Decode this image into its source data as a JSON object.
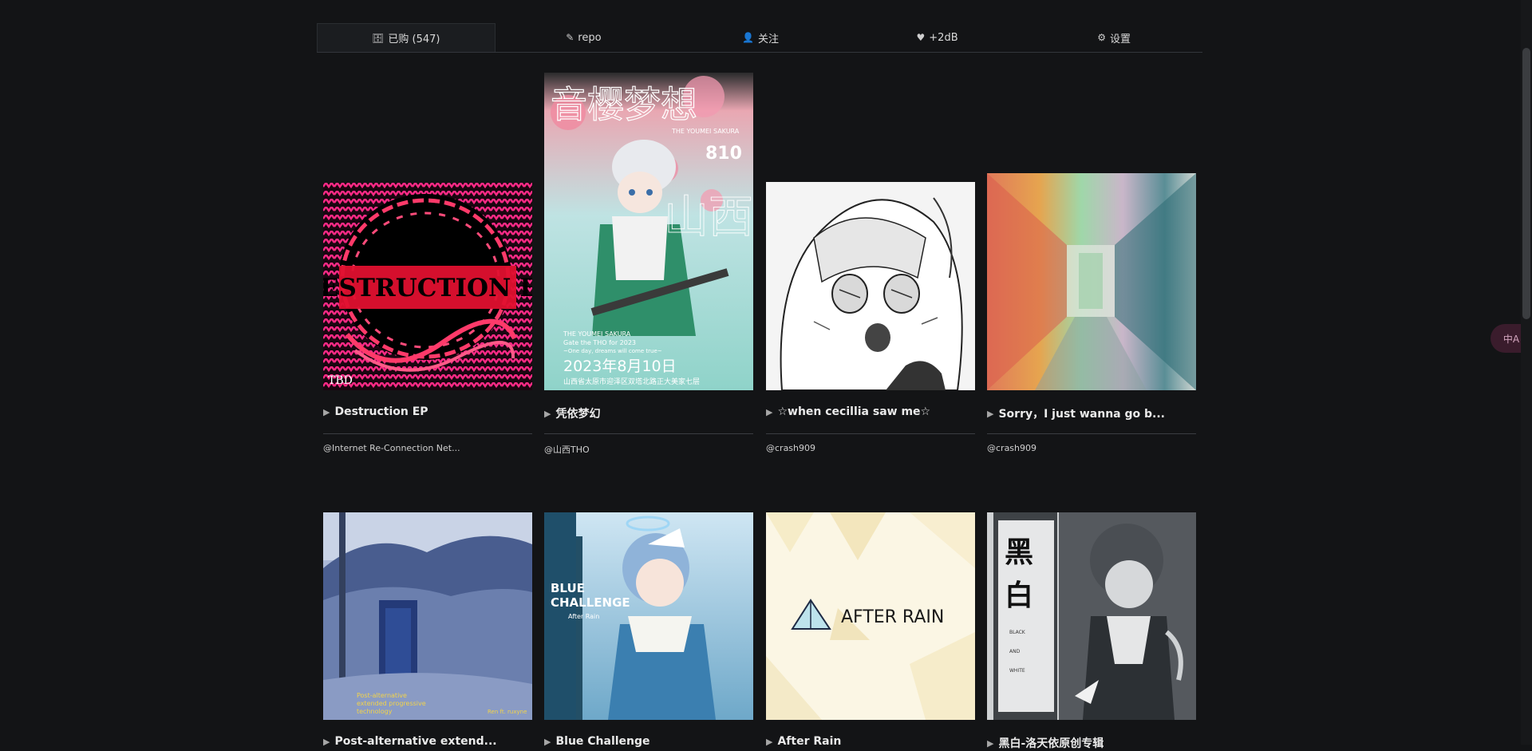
{
  "tabs": [
    {
      "icon": "database-icon",
      "glyph": "🗄",
      "label": "已购 (547)",
      "active": true
    },
    {
      "icon": "edit-icon",
      "glyph": "✎",
      "label": "repo"
    },
    {
      "icon": "user-icon",
      "glyph": "👤",
      "label": "关注"
    },
    {
      "icon": "heart-icon",
      "glyph": "♥",
      "label": "+2dB"
    },
    {
      "icon": "gear-icon",
      "glyph": "⚙",
      "label": "设置"
    }
  ],
  "albums": [
    {
      "title": "Destruction EP",
      "artist": "@Internet Re-Connection Net..."
    },
    {
      "title": "凭依梦幻",
      "artist": "@山西THO"
    },
    {
      "title": "☆when cecillia saw me☆",
      "artist": "@crash909"
    },
    {
      "title": "Sorry，I just wanna go b...",
      "artist": "@crash909"
    },
    {
      "title": "Post-alternative extend...",
      "artist": ""
    },
    {
      "title": "Blue Challenge",
      "artist": ""
    },
    {
      "title": "After Rain",
      "artist": ""
    },
    {
      "title": "黑白-洛天依原创专辑",
      "artist": ""
    }
  ],
  "covers": {
    "destruction": {
      "text": "DESTRUCTION EP",
      "logo": "TBD"
    },
    "ping_yi": {
      "big": "音樱梦想",
      "en": "THE YOUMEI SAKURA",
      "num": "810",
      "side": "山西 THO",
      "sub1": "THE YOUMEI SAKURA",
      "sub2": "Gate the THO for 2023",
      "sub3": "~One day, dreams will come true~",
      "date": "2023年8月10日",
      "addr": "山西省太原市迎泽区双塔北路正大美家七层"
    },
    "post_alt": {
      "line1": "Post-alternative",
      "line2": "extended progressive",
      "line3": "technology",
      "credit": "Ren ft. ruxyne"
    },
    "blue": {
      "line1": "BLUE",
      "line2": "CHALLENGE",
      "line3": "After Rain"
    },
    "after_rain": {
      "text": "AFTER RAIN"
    },
    "heibai": {
      "kanji": "黑白",
      "en1": "BLACK",
      "en2": "AND",
      "en3": "WHITE"
    }
  },
  "translate_label": "中A",
  "colors": {
    "background": "#131416",
    "accent": "#3a1c2c"
  }
}
